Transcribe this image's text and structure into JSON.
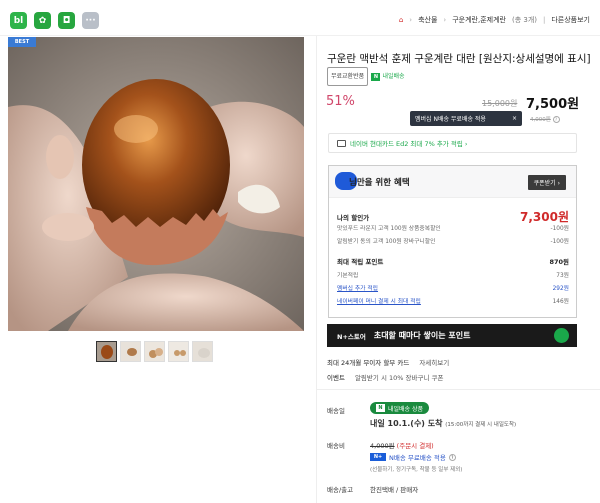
{
  "topbar": {
    "icons": [
      {
        "name": "brand-app-icon",
        "glyph": "bl",
        "color": "#2eb44a"
      },
      {
        "name": "shopping-app-icon",
        "glyph": "✿",
        "color": "#27a63f"
      },
      {
        "name": "bookmark-app-icon",
        "glyph": "◘",
        "color": "#27a63f"
      },
      {
        "name": "more-apps-icon",
        "glyph": "···",
        "color": "#b9bfc8"
      }
    ],
    "breadcrumb": {
      "home": "⌂",
      "items": [
        "축산물",
        "구운계란,훈제계란",
        "(총 3개)",
        "다른상품보기"
      ]
    }
  },
  "gallery": {
    "badge": "BEST"
  },
  "product": {
    "title": "구운란 맥반석 훈제 구운계란 대란 [원산지:상세설명에 표시]",
    "tag_free": "무료교환반품",
    "tag_delivery": "내일배송",
    "discount": "51%",
    "original_price": "15,000원",
    "sale_price": "7,500원",
    "tooltip": "멤버십 N배송 무료배송 적용",
    "tooltip_close": "×",
    "tooltip_side": "4,000원",
    "card_promo": "네이버 현대카드 Ed2 최대 7% 추가 적립 ›"
  },
  "benefit": {
    "title": "님만을 위한 혜택",
    "coupon_button": "쿠폰받기 ›",
    "my_price_label": "나의 할인가",
    "my_price_value": "7,300원",
    "discount_lines": [
      {
        "label": "맛있푸드 라운지 고객 100원 상품중복할인",
        "value": "-100원"
      },
      {
        "label": "알림받기 동의 고객 100원 장바구니할인",
        "value": "-100원"
      }
    ],
    "points_label": "최대 적립 포인트",
    "points_value": "870원",
    "point_lines": [
      {
        "label": "기본적립",
        "value": "73원",
        "blue": false
      },
      {
        "label": "멤버십 추가 적립",
        "value": "292원",
        "blue": true
      },
      {
        "label": "네이버페이 머니 결제 시 최대 적립",
        "value": "146원",
        "blue": true
      }
    ]
  },
  "banner": {
    "logo": "N+스토어",
    "text": "초대할 때마다 쌓이는 포인트"
  },
  "card_info": {
    "text": "최대 24개월 무이자 할부 카드",
    "link": "자세히보기"
  },
  "event": {
    "label": "이벤트",
    "text": "알림받기 시 10% 장바구니 쿠폰"
  },
  "delivery": {
    "date_label": "배송일",
    "pill": "내일배송 상품",
    "date_text": "내일 10.1.(수) 도착",
    "date_note": "(15:00까지 결제 시 내일도착)",
    "fee_label": "배송비",
    "fee_original": "4,000원",
    "fee_note": "(주문시 결제)",
    "fee_n": "N배송 무료배송 적용",
    "fee_sub": "(선물하기, 정기구독, 착불 등 일부 제외)",
    "carrier_label": "배송/출고",
    "carrier_value": "한진택배 / 판매자"
  }
}
